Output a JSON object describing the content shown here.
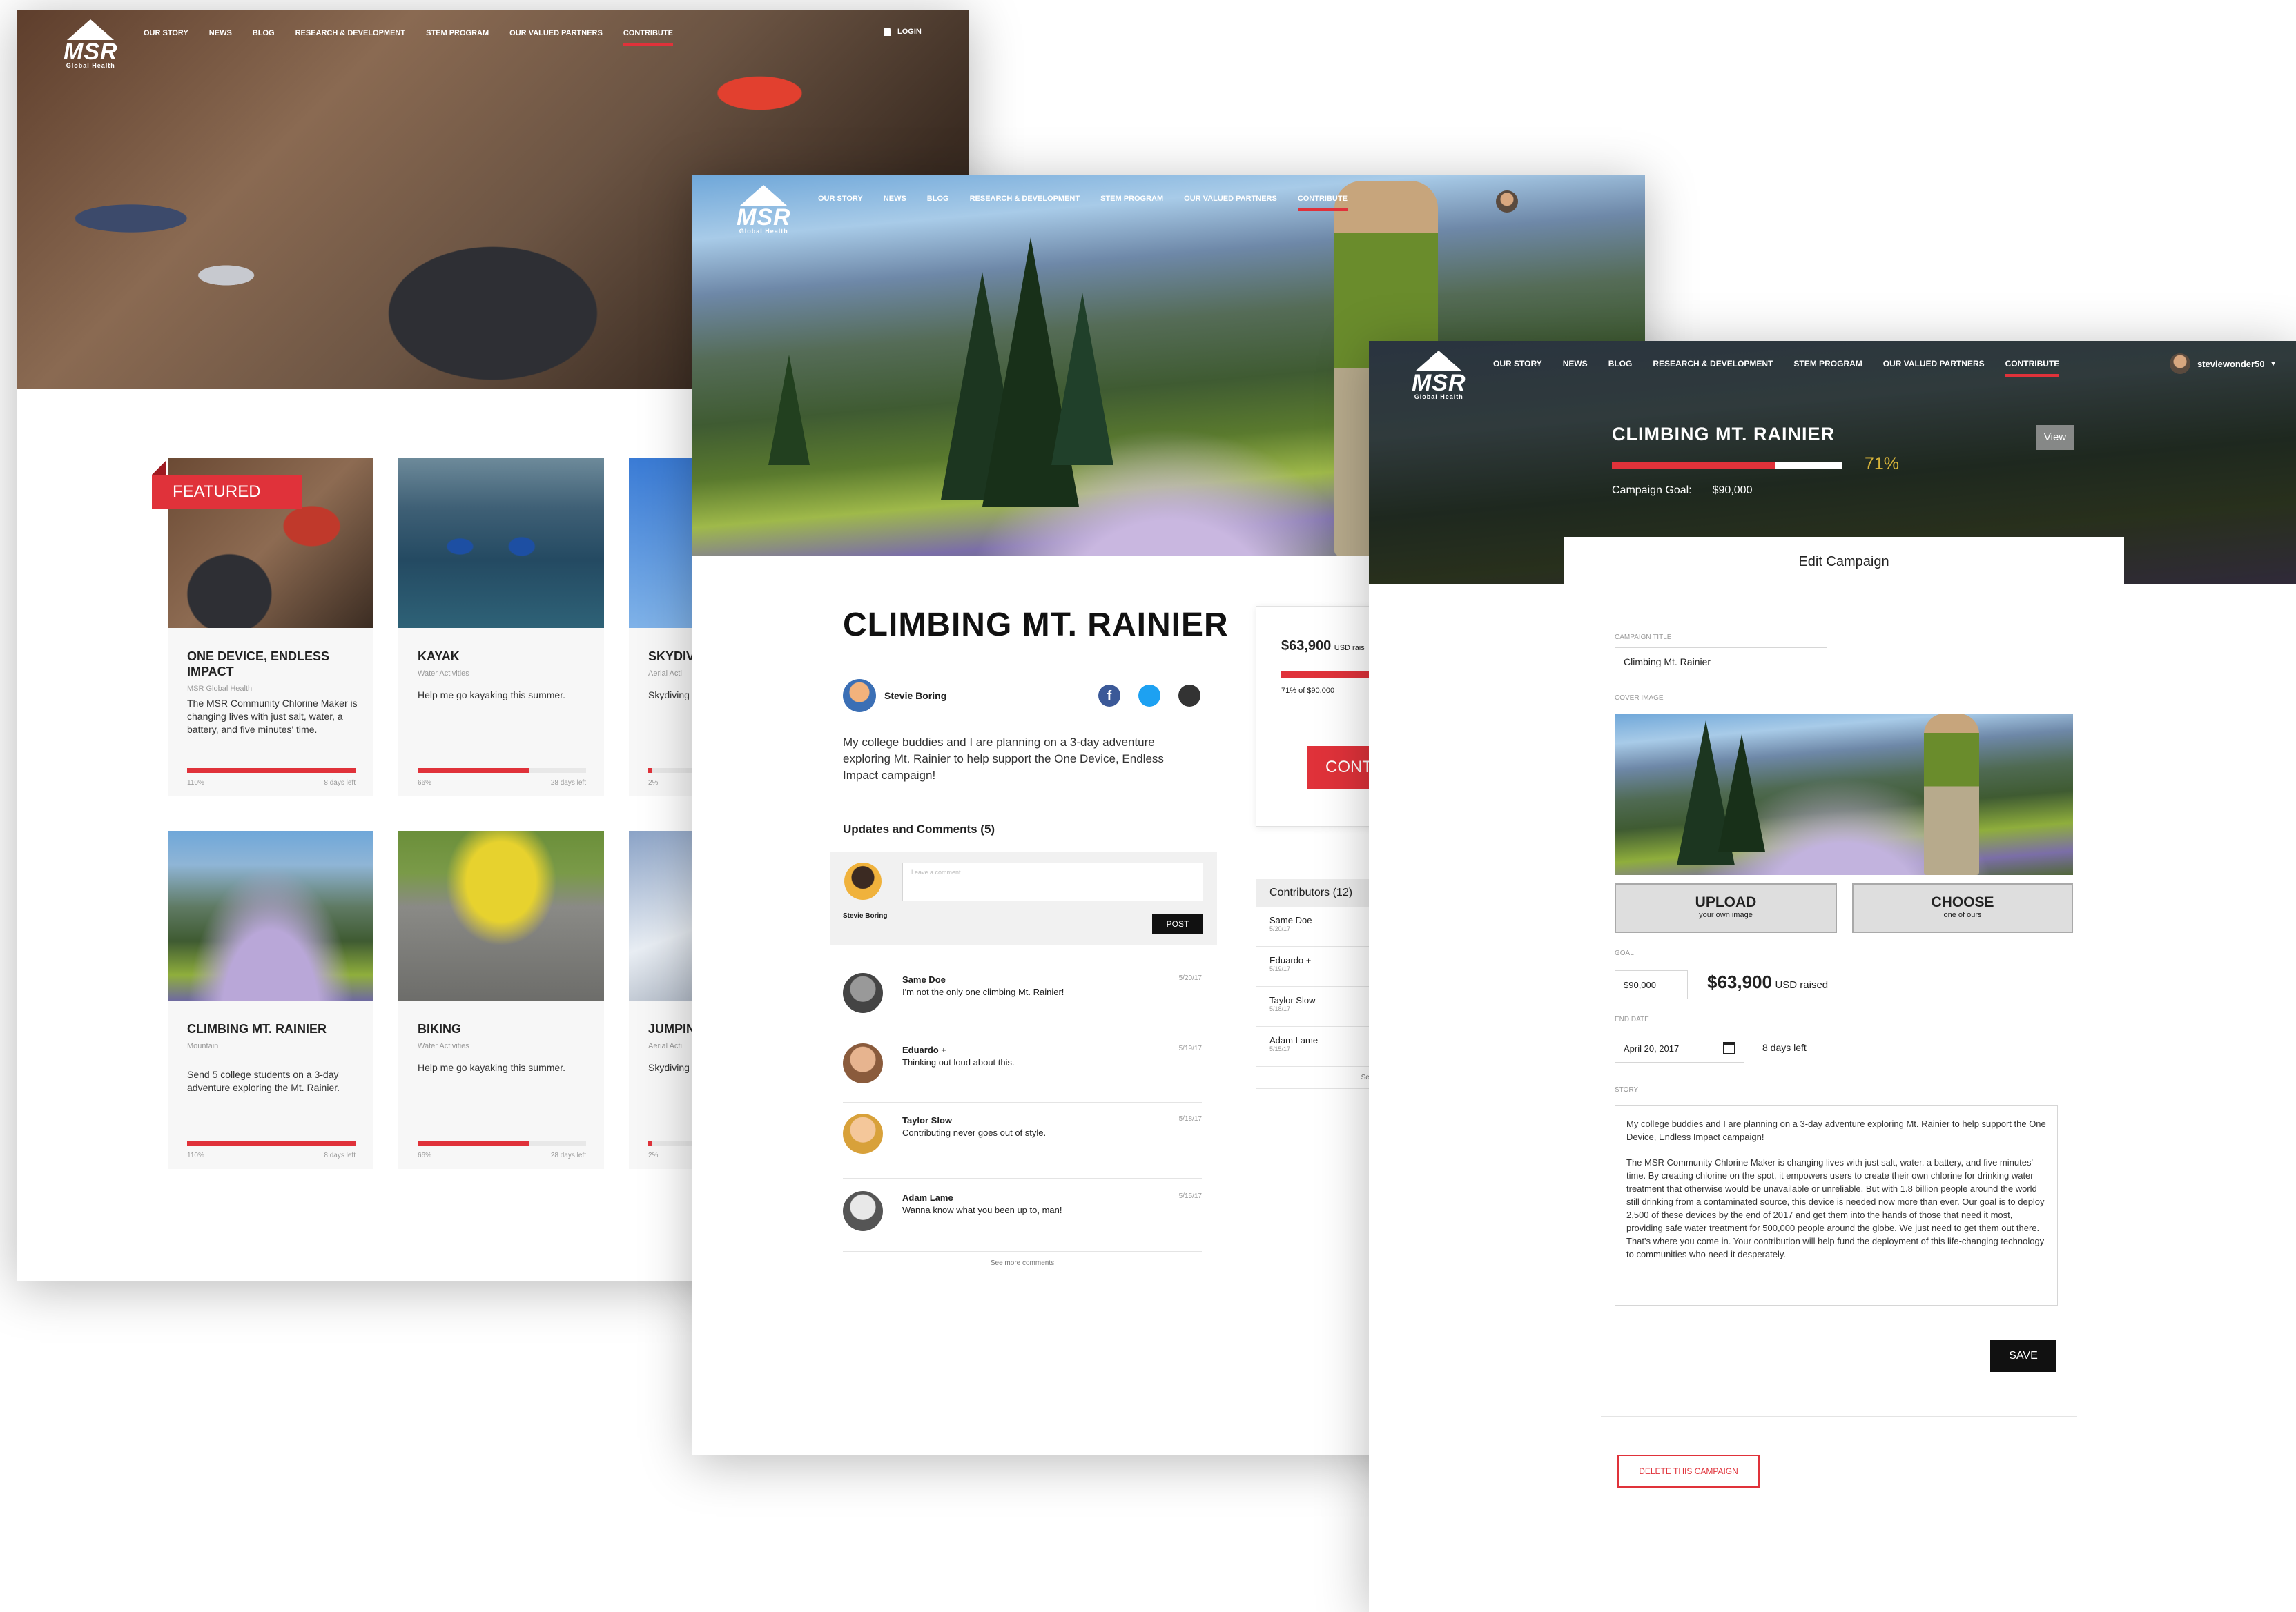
{
  "colors": {
    "accent": "#e0323a",
    "dark": "#111111",
    "card_bg": "#f7f7f7"
  },
  "nav": {
    "items": [
      "Our Story",
      "News",
      "Blog",
      "Research & Development",
      "STEM Program",
      "Our Valued Partners",
      "Contribute"
    ],
    "active": "Contribute",
    "login": "Login"
  },
  "logo": {
    "brand": "MSR",
    "sub": "Global Health"
  },
  "browse": {
    "featured_label": "Featured",
    "cards": [
      {
        "title": "One Device, Endless Impact",
        "category": "MSR Global Health",
        "description": "The MSR Community Chlorine Maker is changing lives with just salt, water, a battery, and five minutes' time.",
        "progress": 1.1,
        "pct_label": "110%",
        "left_label": "8 days left"
      },
      {
        "title": "Kayak",
        "category": "Water Activities",
        "description": "Help me go kayaking this summer.",
        "progress": 0.66,
        "pct_label": "66%",
        "left_label": "28 days left"
      },
      {
        "title": "Skydiv",
        "category": "Aerial Acti",
        "description": "Skydiving bucket lis",
        "progress": 0.02,
        "pct_label": "2%",
        "left_label": ""
      },
      {
        "title": "Climbing Mt. Rainier",
        "category": "Mountain",
        "description": "Send 5 college students on a 3-day adventure exploring the Mt. Rainier.",
        "progress": 1.1,
        "pct_label": "110%",
        "left_label": "8 days left"
      },
      {
        "title": "Biking",
        "category": "Water Activities",
        "description": "Help me go kayaking this summer.",
        "progress": 0.66,
        "pct_label": "66%",
        "left_label": "28 days left"
      },
      {
        "title": "Jumpin",
        "category": "Aerial Acti",
        "description": "Skydiving bucket lis",
        "progress": 0.02,
        "pct_label": "2%",
        "left_label": ""
      }
    ]
  },
  "detail": {
    "title": "Climbing Mt. Rainier",
    "author": "Stevie Boring",
    "story": "My college buddies and I are planning on a 3-day adventure exploring Mt. Rainier to help support the One Device, Endless Impact campaign!",
    "raised": "$63,900",
    "raised_suffix": "USD rais",
    "goal_line": "71% of $90,000",
    "contribute_label": "CONT",
    "updates_heading": "Updates and Comments (5)",
    "comment_placeholder": "Leave a comment",
    "commenter": "Stevie Boring",
    "post_label": "Post",
    "comments": [
      {
        "name": "Same Doe",
        "text": "I'm not the only one climbing Mt. Rainier!",
        "date": "5/20/17"
      },
      {
        "name": "Eduardo +",
        "text": "Thinking out loud about this.",
        "date": "5/19/17"
      },
      {
        "name": "Taylor Slow",
        "text": "Contributing never goes out of style.",
        "date": "5/18/17"
      },
      {
        "name": "Adam Lame",
        "text": "Wanna know what you been up to, man!",
        "date": "5/15/17"
      }
    ],
    "see_more_comments": "See more comments",
    "contributors_heading": "Contributors (12)",
    "contributors": [
      {
        "name": "Same Doe",
        "date": "5/20/17"
      },
      {
        "name": "Eduardo +",
        "date": "5/19/17"
      },
      {
        "name": "Taylor Slow",
        "date": "5/18/17"
      },
      {
        "name": "Adam Lame",
        "date": "5/15/17"
      }
    ],
    "see_more_contributors": "See more"
  },
  "edit": {
    "username": "steviewonder50",
    "title": "Climbing Mt. Rainier",
    "view_label": "View",
    "progress": 0.71,
    "progress_label": "71%",
    "goal_label": "Campaign Goal:",
    "goal_value": "$90,000",
    "tab_label": "Edit Campaign",
    "campaign_title_label": "Campaign Title",
    "campaign_title_value": "Climbing Mt. Rainier",
    "cover_image_label": "Cover Image",
    "upload_label": "Upload",
    "upload_sub": "your own image",
    "choose_label": "Choose",
    "choose_sub": "one of ours",
    "goal_field_label": "Goal",
    "goal_field_value": "$90,000",
    "raised": "$63,900",
    "raised_suffix": "USD raised",
    "end_date_label": "End Date",
    "end_date_value": "April 20, 2017",
    "days_left": "8 days left",
    "story_label": "Story",
    "story_p1": "My college buddies and I are planning on a 3-day adventure exploring Mt. Rainier to help support the One Device, Endless Impact campaign!",
    "story_p2": "The MSR Community Chlorine Maker is changing lives with just salt, water, a battery, and five minutes' time. By creating chlorine on the spot, it empowers users to create their own chlorine for drinking water treatment that otherwise would be unavailable or unreliable. But with 1.8 billion people around the world still drinking from a contaminated source, this device is needed now more than ever. Our goal is to deploy 2,500 of these devices by the end of 2017 and get them into the hands of those that need it most, providing safe water treatment for 500,000 people around the globe. We just need to get them out there. That's where you come in. Your contribution will help fund the deployment of this life-changing technology to communities who need it desperately.",
    "save_label": "Save",
    "delete_label": "Delete this campaign"
  }
}
